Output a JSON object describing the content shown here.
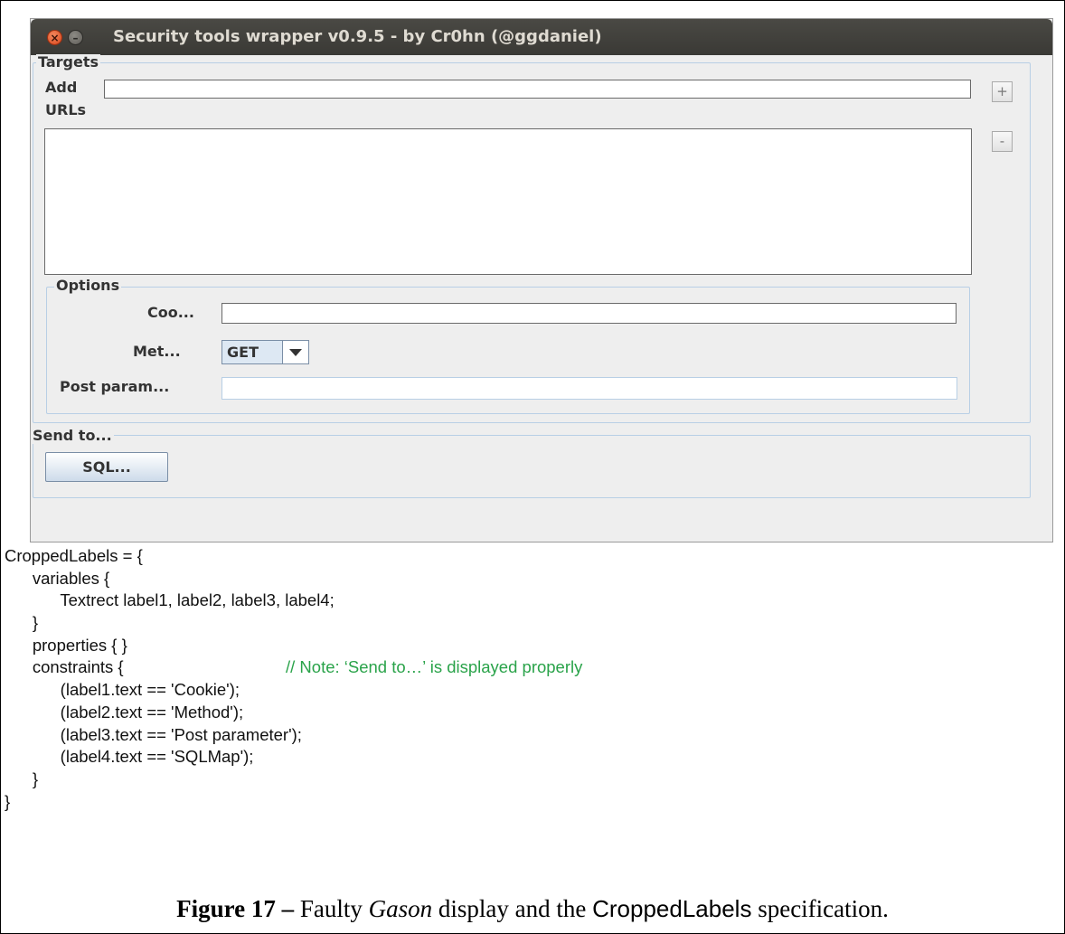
{
  "window": {
    "title": "Security tools wrapper v0.9.5 - by Cr0hn (@ggdaniel)",
    "close_glyph": "×",
    "min_glyph": "–"
  },
  "targets": {
    "legend": "Targets",
    "add_label": "Add",
    "add_value": "",
    "add_button": "+",
    "urls_label": "URLs",
    "remove_button": "-"
  },
  "options": {
    "legend": "Options",
    "cookie_label": "Coo...",
    "cookie_value": "",
    "method_label": "Met...",
    "method_selected": "GET",
    "post_label": "Post param...",
    "post_value": ""
  },
  "send_to": {
    "legend": "Send to...",
    "sql_button": "SQL..."
  },
  "code_lines": [
    "CroppedLabels = {",
    "      variables {",
    "            Textrect label1, label2, label3, label4;",
    "      }",
    "      properties { }",
    "      constraints {",
    "            (label1.text == 'Cookie');",
    "            (label2.text == 'Method');",
    "            (label3.text == 'Post parameter');",
    "            (label4.text == 'SQLMap');",
    "      }",
    "}"
  ],
  "code_comment": "// Note: ‘Send to…’ is displayed properly",
  "caption": {
    "figure": "Figure 17 –",
    "text1": " Faulty ",
    "app": "Gason",
    "text2": " display and the ",
    "spec": "CroppedLabels",
    "text3": " specification."
  },
  "colors": {
    "titlebar": "#3c3b37",
    "window_bg": "#eeeeee",
    "group_border": "#b8cfe5",
    "comment": "#2aa34a",
    "close_button": "#e2582a"
  }
}
